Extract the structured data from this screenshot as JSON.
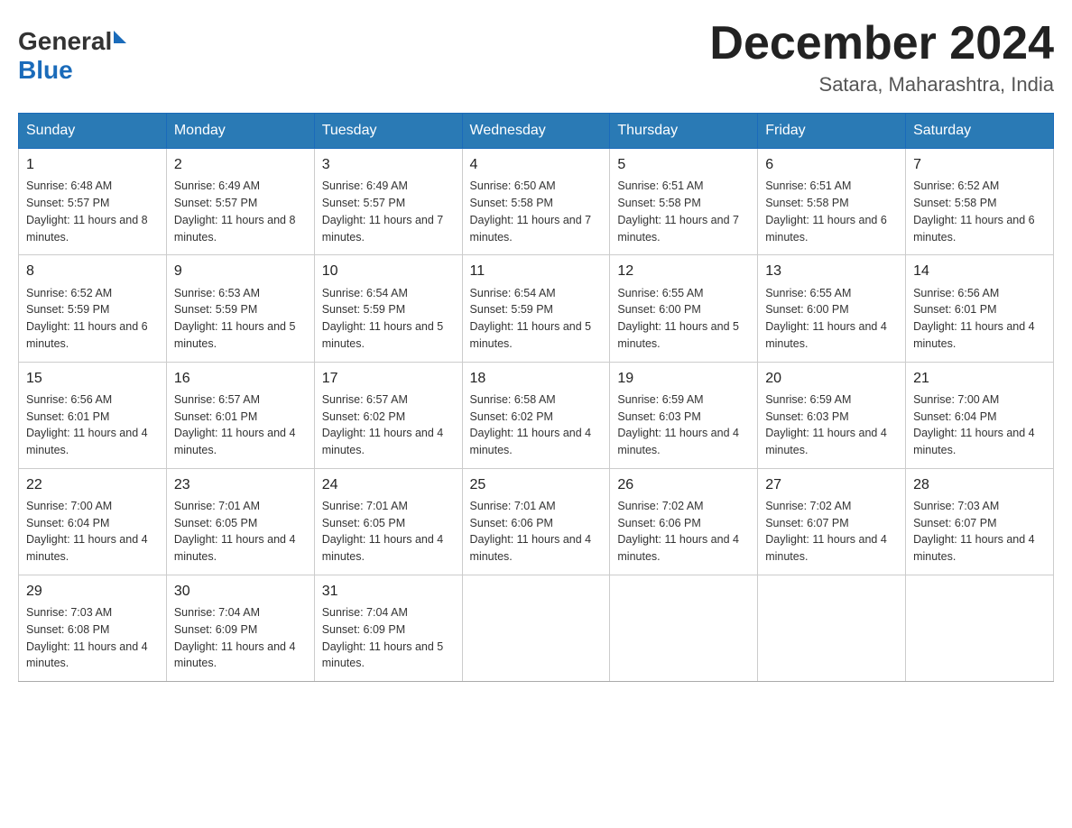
{
  "header": {
    "logo_general": "General",
    "logo_blue": "Blue",
    "month_year": "December 2024",
    "location": "Satara, Maharashtra, India"
  },
  "days_of_week": [
    "Sunday",
    "Monday",
    "Tuesday",
    "Wednesday",
    "Thursday",
    "Friday",
    "Saturday"
  ],
  "weeks": [
    [
      {
        "day": "1",
        "sunrise": "6:48 AM",
        "sunset": "5:57 PM",
        "daylight": "11 hours and 8 minutes."
      },
      {
        "day": "2",
        "sunrise": "6:49 AM",
        "sunset": "5:57 PM",
        "daylight": "11 hours and 8 minutes."
      },
      {
        "day": "3",
        "sunrise": "6:49 AM",
        "sunset": "5:57 PM",
        "daylight": "11 hours and 7 minutes."
      },
      {
        "day": "4",
        "sunrise": "6:50 AM",
        "sunset": "5:58 PM",
        "daylight": "11 hours and 7 minutes."
      },
      {
        "day": "5",
        "sunrise": "6:51 AM",
        "sunset": "5:58 PM",
        "daylight": "11 hours and 7 minutes."
      },
      {
        "day": "6",
        "sunrise": "6:51 AM",
        "sunset": "5:58 PM",
        "daylight": "11 hours and 6 minutes."
      },
      {
        "day": "7",
        "sunrise": "6:52 AM",
        "sunset": "5:58 PM",
        "daylight": "11 hours and 6 minutes."
      }
    ],
    [
      {
        "day": "8",
        "sunrise": "6:52 AM",
        "sunset": "5:59 PM",
        "daylight": "11 hours and 6 minutes."
      },
      {
        "day": "9",
        "sunrise": "6:53 AM",
        "sunset": "5:59 PM",
        "daylight": "11 hours and 5 minutes."
      },
      {
        "day": "10",
        "sunrise": "6:54 AM",
        "sunset": "5:59 PM",
        "daylight": "11 hours and 5 minutes."
      },
      {
        "day": "11",
        "sunrise": "6:54 AM",
        "sunset": "5:59 PM",
        "daylight": "11 hours and 5 minutes."
      },
      {
        "day": "12",
        "sunrise": "6:55 AM",
        "sunset": "6:00 PM",
        "daylight": "11 hours and 5 minutes."
      },
      {
        "day": "13",
        "sunrise": "6:55 AM",
        "sunset": "6:00 PM",
        "daylight": "11 hours and 4 minutes."
      },
      {
        "day": "14",
        "sunrise": "6:56 AM",
        "sunset": "6:01 PM",
        "daylight": "11 hours and 4 minutes."
      }
    ],
    [
      {
        "day": "15",
        "sunrise": "6:56 AM",
        "sunset": "6:01 PM",
        "daylight": "11 hours and 4 minutes."
      },
      {
        "day": "16",
        "sunrise": "6:57 AM",
        "sunset": "6:01 PM",
        "daylight": "11 hours and 4 minutes."
      },
      {
        "day": "17",
        "sunrise": "6:57 AM",
        "sunset": "6:02 PM",
        "daylight": "11 hours and 4 minutes."
      },
      {
        "day": "18",
        "sunrise": "6:58 AM",
        "sunset": "6:02 PM",
        "daylight": "11 hours and 4 minutes."
      },
      {
        "day": "19",
        "sunrise": "6:59 AM",
        "sunset": "6:03 PM",
        "daylight": "11 hours and 4 minutes."
      },
      {
        "day": "20",
        "sunrise": "6:59 AM",
        "sunset": "6:03 PM",
        "daylight": "11 hours and 4 minutes."
      },
      {
        "day": "21",
        "sunrise": "7:00 AM",
        "sunset": "6:04 PM",
        "daylight": "11 hours and 4 minutes."
      }
    ],
    [
      {
        "day": "22",
        "sunrise": "7:00 AM",
        "sunset": "6:04 PM",
        "daylight": "11 hours and 4 minutes."
      },
      {
        "day": "23",
        "sunrise": "7:01 AM",
        "sunset": "6:05 PM",
        "daylight": "11 hours and 4 minutes."
      },
      {
        "day": "24",
        "sunrise": "7:01 AM",
        "sunset": "6:05 PM",
        "daylight": "11 hours and 4 minutes."
      },
      {
        "day": "25",
        "sunrise": "7:01 AM",
        "sunset": "6:06 PM",
        "daylight": "11 hours and 4 minutes."
      },
      {
        "day": "26",
        "sunrise": "7:02 AM",
        "sunset": "6:06 PM",
        "daylight": "11 hours and 4 minutes."
      },
      {
        "day": "27",
        "sunrise": "7:02 AM",
        "sunset": "6:07 PM",
        "daylight": "11 hours and 4 minutes."
      },
      {
        "day": "28",
        "sunrise": "7:03 AM",
        "sunset": "6:07 PM",
        "daylight": "11 hours and 4 minutes."
      }
    ],
    [
      {
        "day": "29",
        "sunrise": "7:03 AM",
        "sunset": "6:08 PM",
        "daylight": "11 hours and 4 minutes."
      },
      {
        "day": "30",
        "sunrise": "7:04 AM",
        "sunset": "6:09 PM",
        "daylight": "11 hours and 4 minutes."
      },
      {
        "day": "31",
        "sunrise": "7:04 AM",
        "sunset": "6:09 PM",
        "daylight": "11 hours and 5 minutes."
      },
      null,
      null,
      null,
      null
    ]
  ]
}
